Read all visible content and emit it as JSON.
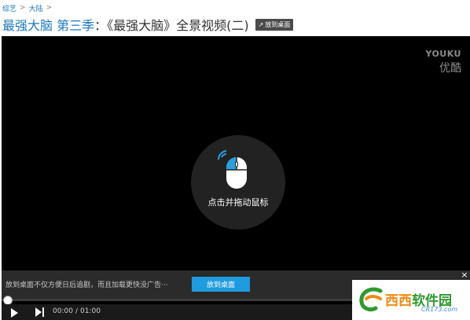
{
  "breadcrumb": {
    "items": [
      "综艺",
      "大陆"
    ],
    "separator": ">"
  },
  "title": {
    "show": "最强大脑 第三季",
    "rest": "：《最强大脑》全景视频(二)"
  },
  "pin_button": {
    "label": "放到桌面",
    "icon": "pin-icon"
  },
  "player": {
    "watermark_en": "YOUKU",
    "watermark_cn": "优酷",
    "vr_hint": "点击并拖动鼠标",
    "mouse_icon": "mouse-drag-icon"
  },
  "promo": {
    "text": "放到桌面不仅方便日后追剧，而且加载更快没广告···",
    "button": "放到桌面",
    "close": "×"
  },
  "controls": {
    "current_time": "00:00",
    "separator": "/",
    "duration": "01:00",
    "progress": 0
  },
  "site_logo": {
    "main_a": "西西",
    "main_b": "软件园",
    "sub": "CR173.com"
  },
  "colors": {
    "link_blue": "#1a78c2",
    "accent_blue": "#1f9bdf",
    "player_bg": "#000000",
    "logo_orange": "#f08a12",
    "logo_green": "#2e9a2e"
  }
}
